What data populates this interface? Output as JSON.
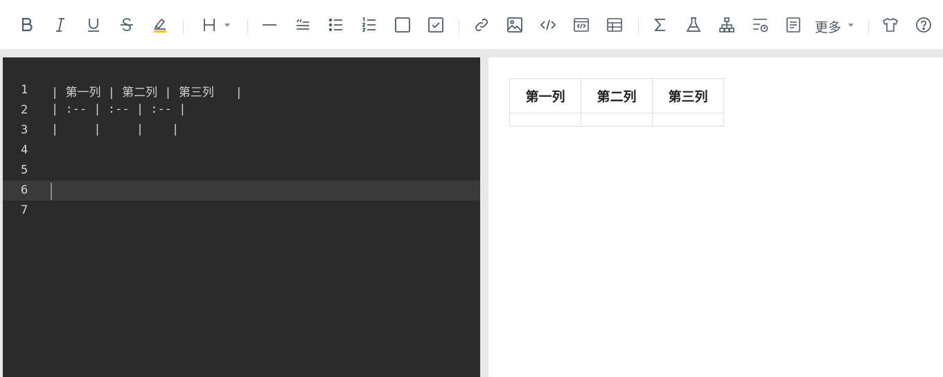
{
  "toolbar": {
    "buttons": [
      {
        "name": "bold",
        "icon": "bold-icon"
      },
      {
        "name": "italic",
        "icon": "italic-icon"
      },
      {
        "name": "underline",
        "icon": "underline-icon"
      },
      {
        "name": "strikethrough",
        "icon": "strikethrough-icon"
      },
      {
        "name": "highlight",
        "icon": "highlight-icon"
      },
      {
        "name": "heading",
        "icon": "heading-icon"
      },
      {
        "name": "horizontal-rule",
        "icon": "hr-icon"
      },
      {
        "name": "quote",
        "icon": "quote-icon"
      },
      {
        "name": "unordered-list",
        "icon": "bullet-list-icon"
      },
      {
        "name": "ordered-list",
        "icon": "numbered-list-icon"
      },
      {
        "name": "checkbox",
        "icon": "checkbox-icon"
      },
      {
        "name": "checked-checkbox",
        "icon": "checkbox-checked-icon"
      },
      {
        "name": "link",
        "icon": "link-icon"
      },
      {
        "name": "image",
        "icon": "image-icon"
      },
      {
        "name": "inline-code",
        "icon": "code-icon"
      },
      {
        "name": "code-block",
        "icon": "code-block-icon"
      },
      {
        "name": "table",
        "icon": "table-icon"
      },
      {
        "name": "formula",
        "icon": "sigma-icon"
      },
      {
        "name": "experiment",
        "icon": "flask-icon"
      },
      {
        "name": "graph",
        "icon": "graph-icon"
      },
      {
        "name": "timeline",
        "icon": "timeline-icon"
      },
      {
        "name": "toc",
        "icon": "document-icon"
      },
      {
        "name": "theme",
        "icon": "shirt-icon"
      },
      {
        "name": "help",
        "icon": "help-icon"
      }
    ],
    "heading_label": "H",
    "more_label": "更多",
    "highlight_color": "#f5c518"
  },
  "editor": {
    "background": "#2b2b2b",
    "active_line": 6,
    "lines": [
      {
        "num": "1",
        "text": "| 第一列 | 第二列 | 第三列   |"
      },
      {
        "num": "2",
        "text": "| :-- | :-- | :-- |"
      },
      {
        "num": "3",
        "text": "|     |     |    |"
      },
      {
        "num": "4",
        "text": ""
      },
      {
        "num": "5",
        "text": ""
      },
      {
        "num": "6",
        "text": ""
      },
      {
        "num": "7",
        "text": ""
      }
    ]
  },
  "preview": {
    "table": {
      "headers": [
        "第一列",
        "第二列",
        "第三列"
      ],
      "rows": [
        [
          "",
          "",
          ""
        ]
      ]
    }
  }
}
